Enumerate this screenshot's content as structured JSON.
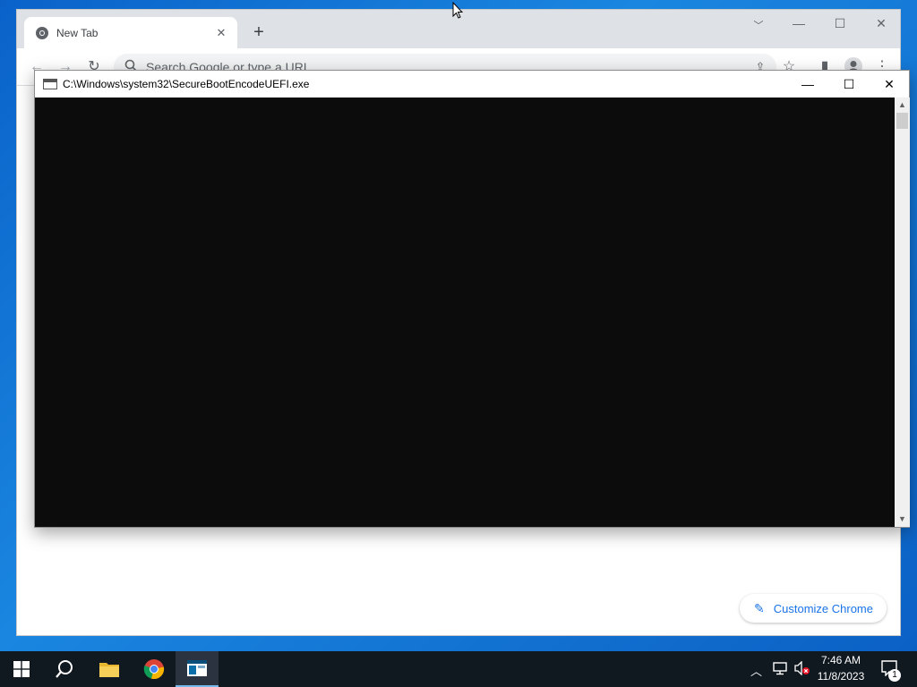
{
  "chrome": {
    "tab_title": "New Tab",
    "omnibox_placeholder": "Search Google or type a URL",
    "customize_label": "Customize Chrome"
  },
  "console": {
    "title": "C:\\Windows\\system32\\SecureBootEncodeUEFI.exe"
  },
  "taskbar": {
    "time": "7:46 AM",
    "date": "11/8/2023",
    "notification_count": "1"
  },
  "colors": {
    "desktop": "#0a62c9",
    "console_bg": "#0c0c0c",
    "accent": "#1a73e8",
    "taskbar": "#101820"
  }
}
